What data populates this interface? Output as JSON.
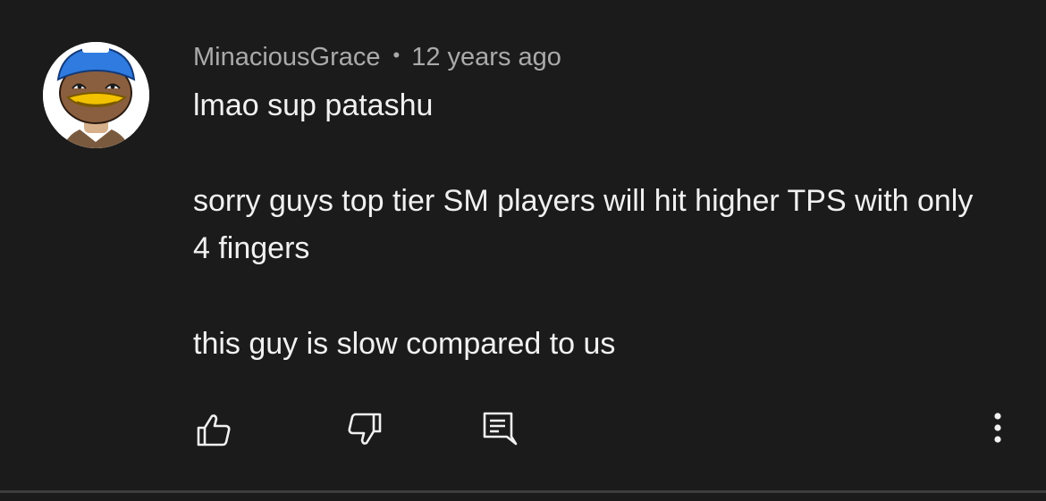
{
  "comment": {
    "author": "MinaciousGrace",
    "separator": "•",
    "timestamp": "12 years ago",
    "paragraphs": [
      "lmao sup patashu",
      "sorry guys top tier SM players will hit higher TPS with only 4 fingers",
      "this guy is slow compared to us"
    ]
  },
  "actions": {
    "like_icon": "thumbs-up-icon",
    "dislike_icon": "thumbs-down-icon",
    "reply_icon": "reply-comment-icon",
    "more_icon": "more-vertical-icon"
  },
  "colors": {
    "background": "#1b1b1b",
    "author_text": "#aaaaaa",
    "body_text": "#f1f1f1",
    "divider": "#3d3d3d"
  }
}
